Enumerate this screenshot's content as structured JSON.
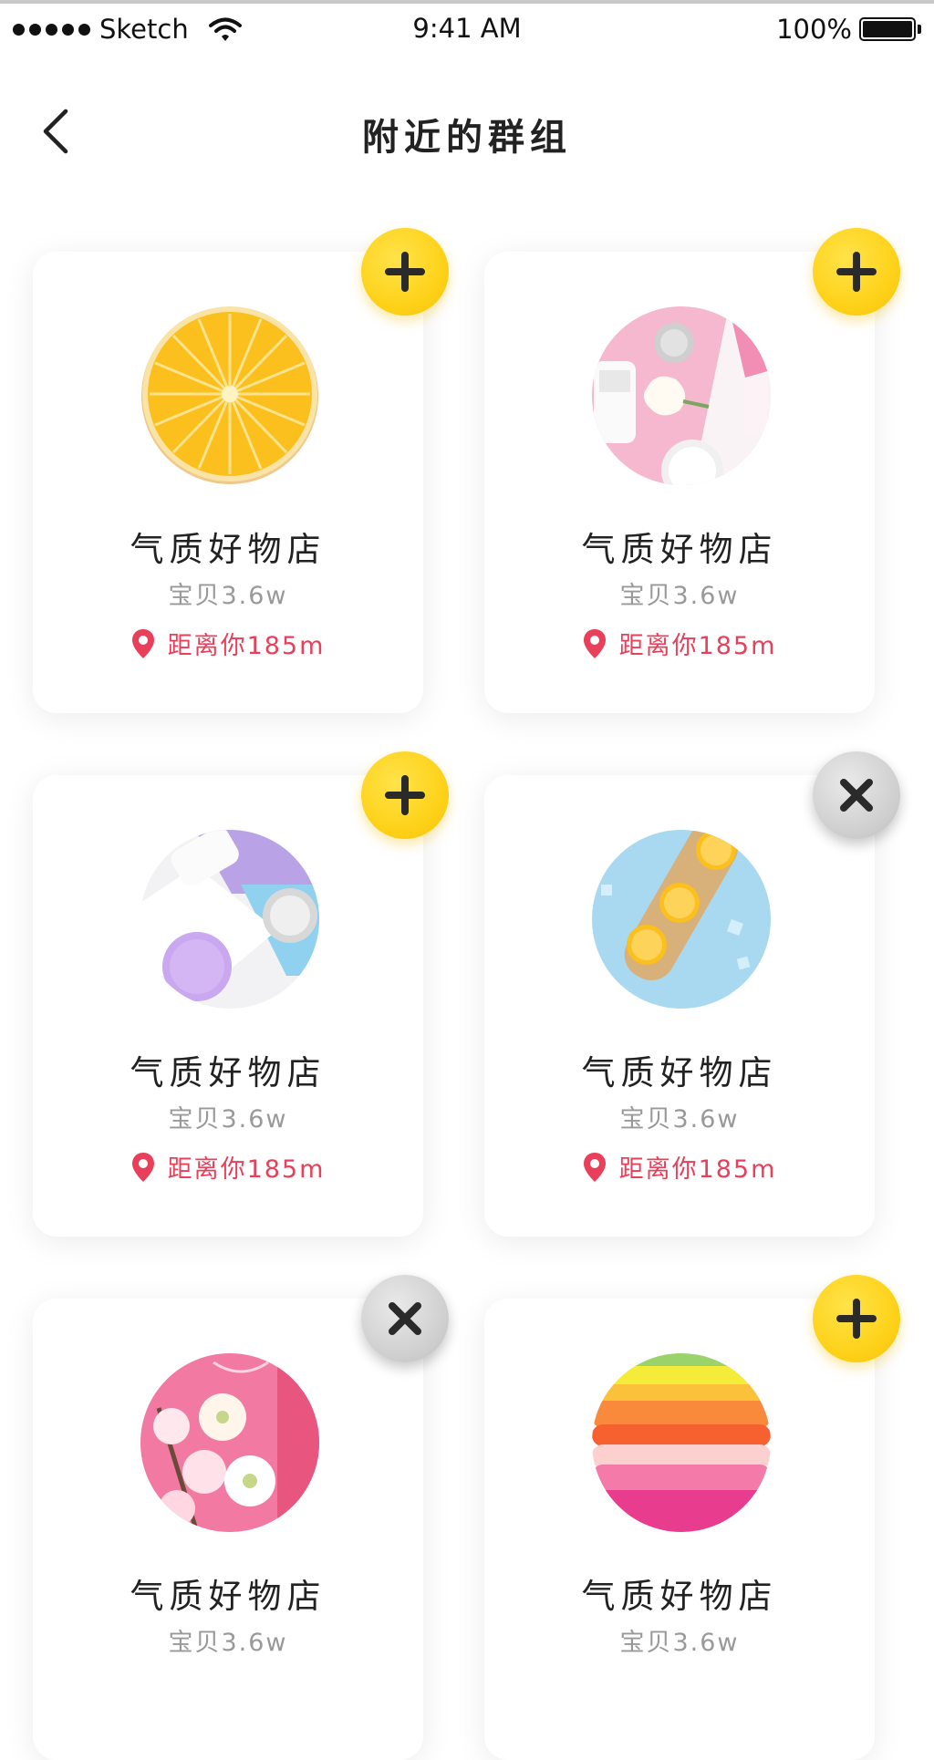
{
  "status_bar": {
    "carrier": "Sketch",
    "time": "9:41 AM",
    "battery": "100%"
  },
  "nav": {
    "title": "附近的群组",
    "back_icon": "chevron-left-icon"
  },
  "colors": {
    "accent_yellow": "#fed21a",
    "distance_red": "#e8405a",
    "remove_gray": "#cfcfcf"
  },
  "groups": [
    {
      "name": "气质好物店",
      "count": "宝贝3.6w",
      "distance": "距离你185m",
      "action": "add",
      "image": "orange-slice"
    },
    {
      "name": "气质好物店",
      "count": "宝贝3.6w",
      "distance": "距离你185m",
      "action": "add",
      "image": "pink-cosmetics"
    },
    {
      "name": "气质好物店",
      "count": "宝贝3.6w",
      "distance": "距离你185m",
      "action": "add",
      "image": "purple-cosmetics"
    },
    {
      "name": "气质好物店",
      "count": "宝贝3.6w",
      "distance": "距离你185m",
      "action": "remove",
      "image": "orange-board"
    },
    {
      "name": "气质好物店",
      "count": "宝贝3.6w",
      "distance": "",
      "action": "remove",
      "image": "blossom-pink"
    },
    {
      "name": "气质好物店",
      "count": "宝贝3.6w",
      "distance": "",
      "action": "add",
      "image": "colorful-fabric"
    }
  ]
}
